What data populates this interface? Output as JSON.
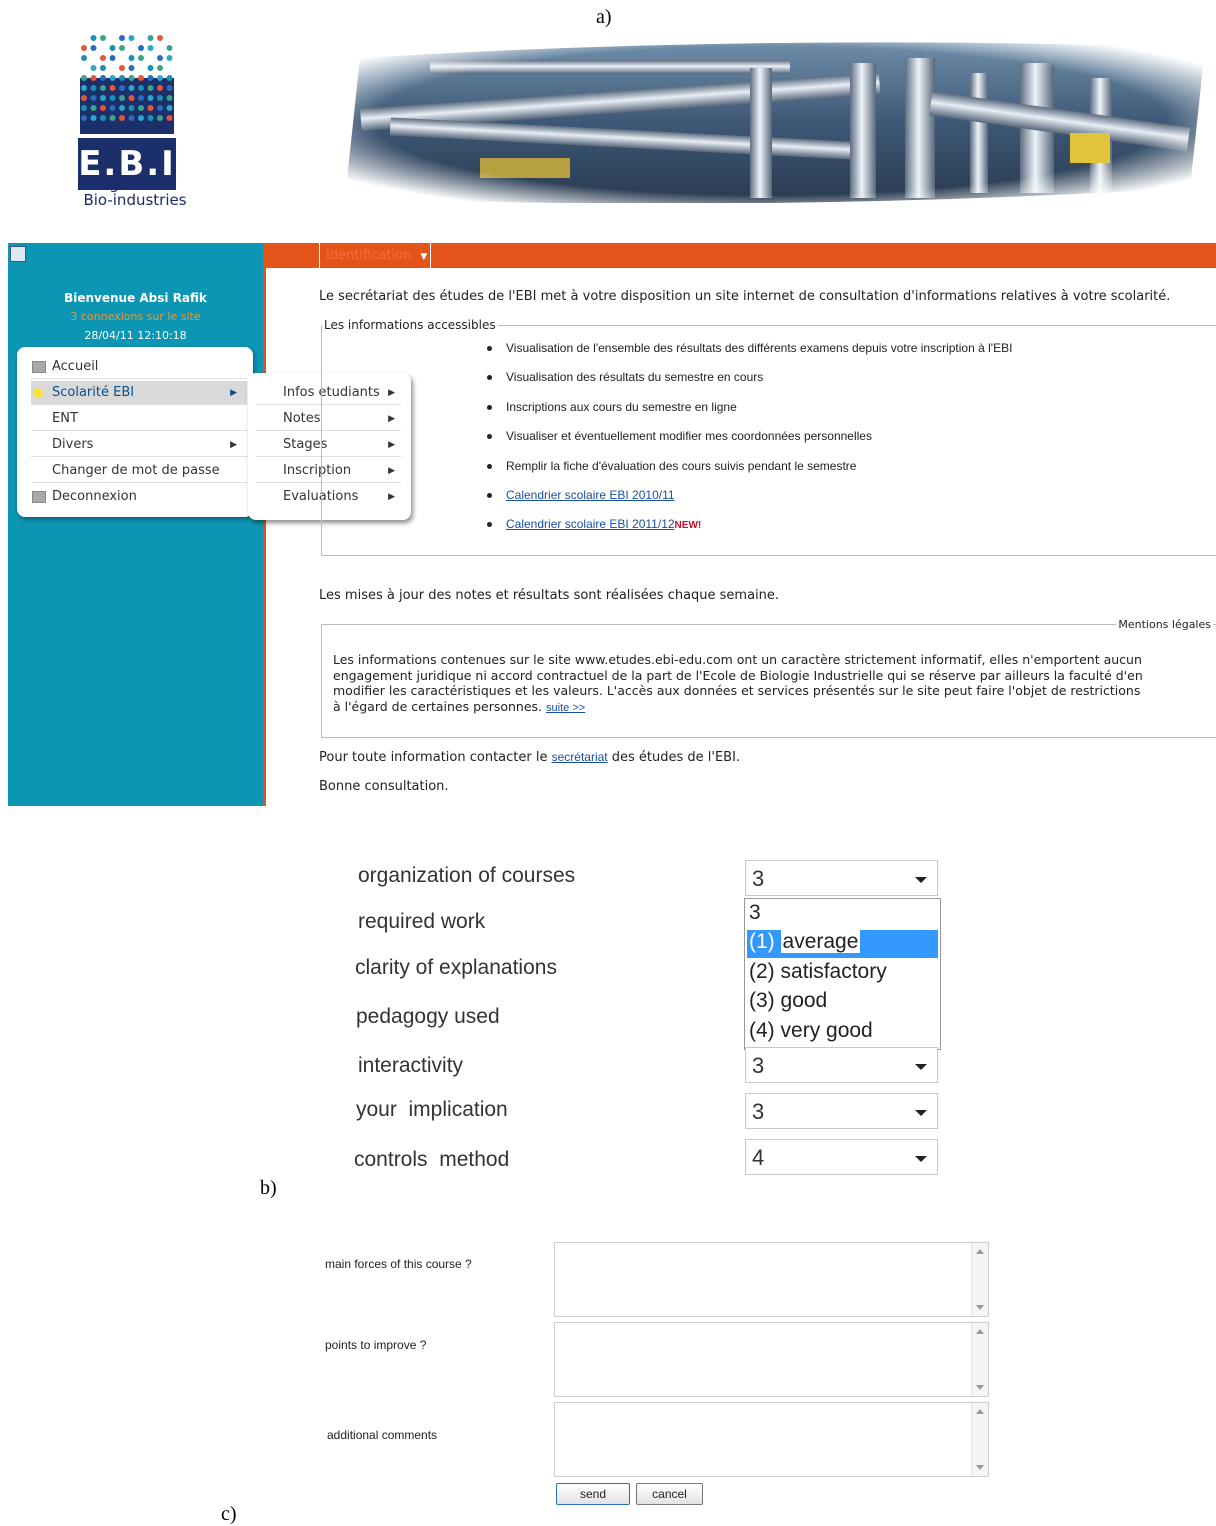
{
  "labels": {
    "a": "a)",
    "b": "b)",
    "c": "c)"
  },
  "logo": {
    "brand": "E.B.I",
    "line1": "Ingénieurs",
    "line2": "Bio-industries"
  },
  "app": {
    "tab": "Identification",
    "welcome": {
      "name": "Bienvenue Absi Rafik",
      "connections": "3 connexions sur le site",
      "datetime": "28/04/11 12:10:18"
    },
    "menu": [
      "Accueil",
      "Scolarité EBI",
      "ENT",
      "Divers",
      "Changer de mot de passe",
      "Deconnexion"
    ],
    "submenu": [
      "Infos etudiants",
      "Notes",
      "Stages",
      "Inscription",
      "Evaluations"
    ],
    "intro": "Le secrétariat des études de l'EBI met à votre disposition un site internet de consultation d'informations relatives à votre scolarité.",
    "info_legend": "Les informations accessibles",
    "info_items": [
      "Visualisation de l'ensemble des résultats des différents examens depuis votre inscription à l'EBI",
      "Visualisation des résultats du semestre en cours",
      "Inscriptions aux cours du semestre en ligne",
      "Visualiser et éventuellement modifier mes coordonnées personnelles",
      "Remplir la fiche d'évaluation des cours suivis pendant le semestre",
      "Calendrier scolaire EBI 2010/11",
      "Calendrier scolaire EBI 2011/12"
    ],
    "new_badge": "NEW!",
    "updates": "Les mises à jour des notes et résultats sont réalisées chaque semaine.",
    "legal_legend": "Mentions légales",
    "legal_lines": [
      "Les informations contenues sur le site www.etudes.ebi-edu.com ont un caractère strictement informatif, elles n'emportent aucun",
      "engagement juridique ni accord contractuel de la part de l'Ecole de Biologie Industrielle qui se réserve par ailleurs la faculté d'en",
      "modifier les caractéristiques et les valeurs. L'accès aux données et services présentés sur le site peut faire l'objet de restrictions",
      "à l'égard de certaines personnes."
    ],
    "legal_more": "suite >>",
    "contact_pre": "Pour toute information contacter le ",
    "contact_link": "secrétariat",
    "contact_post": " des études de l'EBI.",
    "closing": "Bonne consultation."
  },
  "evaluation": {
    "criteria": [
      "organization of courses",
      "required work",
      "clarity of explanations",
      "pedagogy used",
      "interactivity",
      "your  implication",
      "controls  method"
    ],
    "selected_values": {
      "organization": "3",
      "interactivity": "3",
      "implication": "3",
      "controls": "4"
    },
    "dropdown_current": "3",
    "dropdown_options": [
      {
        "num": "(1)",
        "label": "average"
      },
      {
        "num": "(2)",
        "label": "satisfactory"
      },
      {
        "num": "(3)",
        "label": "good"
      },
      {
        "num": "(4)",
        "label": "very good"
      }
    ],
    "highlight_color": "#3399ff"
  },
  "comments": {
    "fields": [
      "main forces of this course ?",
      "points to improve ?",
      "additional comments"
    ],
    "send": "send",
    "cancel": "cancel"
  }
}
